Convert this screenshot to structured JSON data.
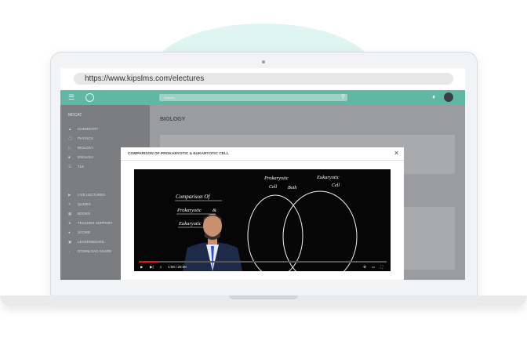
{
  "browser": {
    "url": "https://www.kipslms.com/electures"
  },
  "topbar": {
    "search_placeholder": "Search...",
    "accent_color": "#5fb8a3"
  },
  "sidebar": {
    "section_title": "MDCAT",
    "items": [
      {
        "label": "CHEMISTRY",
        "icon": "flask-icon"
      },
      {
        "label": "PHYSICS",
        "icon": "atom-icon"
      },
      {
        "label": "BIOLOGY",
        "icon": "leaf-icon"
      },
      {
        "label": "ENGLISH",
        "icon": "book-icon"
      },
      {
        "label": "TLE",
        "icon": "list-icon"
      }
    ],
    "items2": [
      {
        "label": "LIVE LECTURES",
        "icon": "video-icon"
      },
      {
        "label": "QUIZES",
        "icon": "quiz-icon"
      },
      {
        "label": "BOOKS",
        "icon": "books-icon"
      },
      {
        "label": "TEACHER SUPPORT",
        "icon": "send-icon"
      },
      {
        "label": "SCORE",
        "icon": "score-icon"
      },
      {
        "label": "LEADERBOARD",
        "icon": "board-icon"
      },
      {
        "label": "DOWNLOAD SHARE",
        "icon": "download-icon"
      }
    ]
  },
  "main": {
    "title": "BIOLOGY"
  },
  "modal": {
    "title": "COMPARISON OF PROKARYOTIC & EUKARYOTIC CELL",
    "video": {
      "board_text": {
        "left_1": "Comparison Of",
        "left_2": "Prokaryotic",
        "left_3": "&",
        "left_4": "Eukaryotic",
        "prok": "Prokaryotic",
        "prok_sub": "Cell",
        "both": "Both",
        "euk": "Eukaryotic",
        "euk_sub": "Cell"
      },
      "time": "1:59 / 25:00",
      "progress": 0.08
    }
  }
}
